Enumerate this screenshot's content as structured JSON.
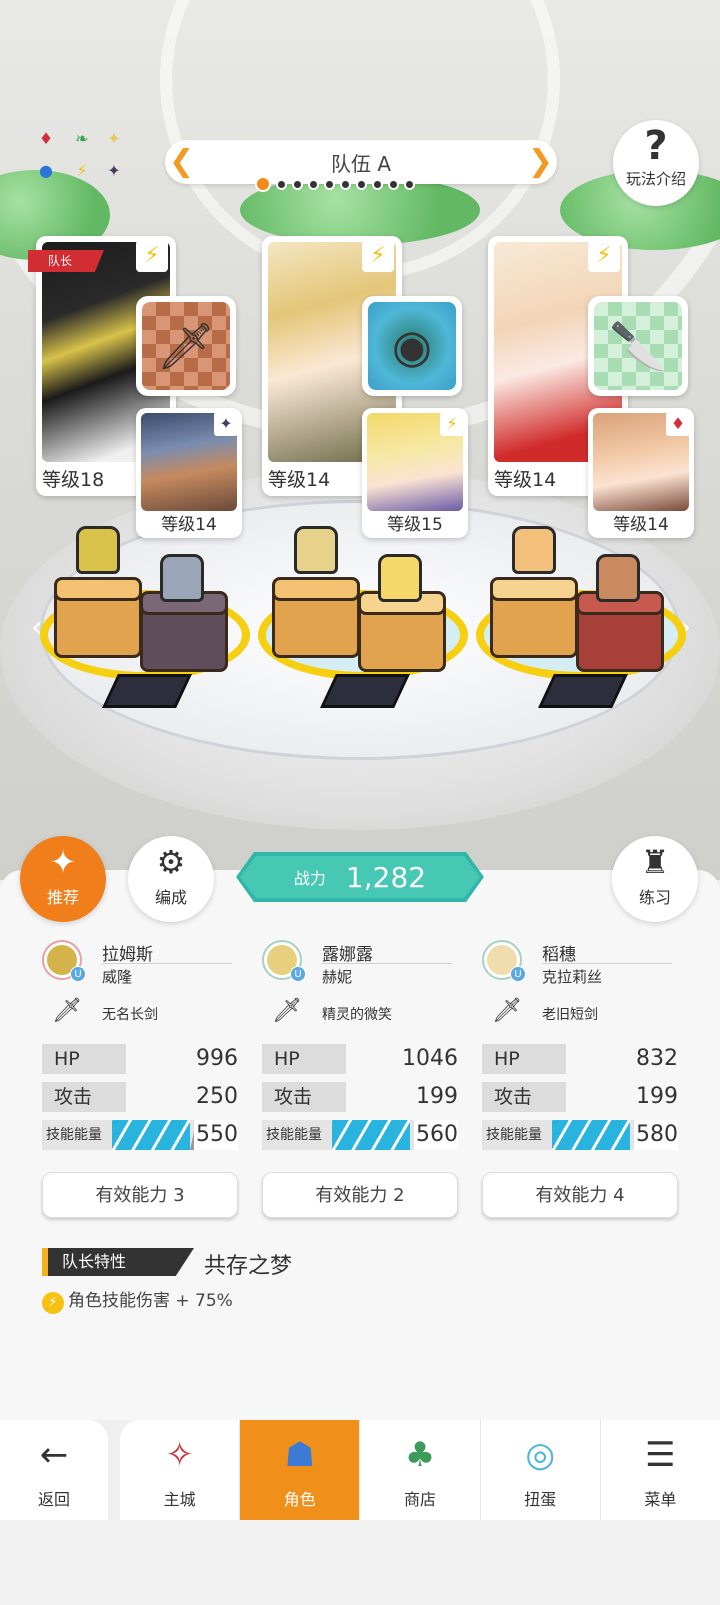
{
  "team": {
    "title": "队伍 A",
    "page_count": 10,
    "active_page": 1
  },
  "help": {
    "label": "玩法介绍"
  },
  "leader_tag": "队长",
  "slots": [
    {
      "main": {
        "level": "等级18",
        "color": "#d8c24a"
      },
      "sub": {
        "level": "等级14",
        "element": "dark"
      },
      "weapon": {
        "bg": "#c47a57",
        "icon": "sword"
      }
    },
    {
      "main": {
        "level": "等级14",
        "color": "#e7d28c"
      },
      "sub": {
        "level": "等级15",
        "element": "lightning"
      },
      "weapon": {
        "bg": "#4fb7d7",
        "icon": "ring"
      }
    },
    {
      "main": {
        "level": "等级14",
        "color": "#f2d5b8"
      },
      "sub": {
        "level": "等级14",
        "element": "fire"
      },
      "weapon": {
        "bg": "#bfe8c5",
        "icon": "dagger"
      }
    }
  ],
  "controls": {
    "recommend": "推荐",
    "formation": "编成",
    "training": "练习"
  },
  "power": {
    "label": "战力",
    "value": "1,282"
  },
  "characters": [
    {
      "name": "拉姆斯",
      "sub_name": "威隆",
      "weapon": "无名长剑",
      "hp_label": "HP",
      "hp": "996",
      "atk_label": "攻击",
      "atk": "250",
      "energy_label": "技能能量",
      "energy": "550",
      "ability": "有效能力 3",
      "avatar_color": "#d3b34a"
    },
    {
      "name": "露娜露",
      "sub_name": "赫妮",
      "weapon": "精灵的微笑",
      "hp_label": "HP",
      "hp": "1046",
      "atk_label": "攻击",
      "atk": "199",
      "energy_label": "技能能量",
      "energy": "560",
      "ability": "有效能力 2",
      "avatar_color": "#e8cf7d"
    },
    {
      "name": "稻穗",
      "sub_name": "克拉莉丝",
      "weapon": "老旧短剑",
      "hp_label": "HP",
      "hp": "832",
      "atk_label": "攻击",
      "atk": "199",
      "energy_label": "技能能量",
      "energy": "580",
      "ability": "有效能力 4",
      "avatar_color": "#f1dcae"
    }
  ],
  "leader_trait": {
    "label": "队长特性",
    "name": "共存之梦",
    "effect": "角色技能伤害 + 75%"
  },
  "nav": {
    "back": "返回",
    "items": [
      {
        "label": "主城",
        "icon": "castle-icon"
      },
      {
        "label": "角色",
        "icon": "character-icon"
      },
      {
        "label": "商店",
        "icon": "shop-icon"
      },
      {
        "label": "扭蛋",
        "icon": "gacha-icon"
      },
      {
        "label": "菜单",
        "icon": "menu-icon"
      }
    ],
    "active": "角色"
  },
  "colors": {
    "accent": "#f0901b",
    "power": "#47c8b5",
    "energy": "#28b4df",
    "leader": "#d22d33"
  }
}
